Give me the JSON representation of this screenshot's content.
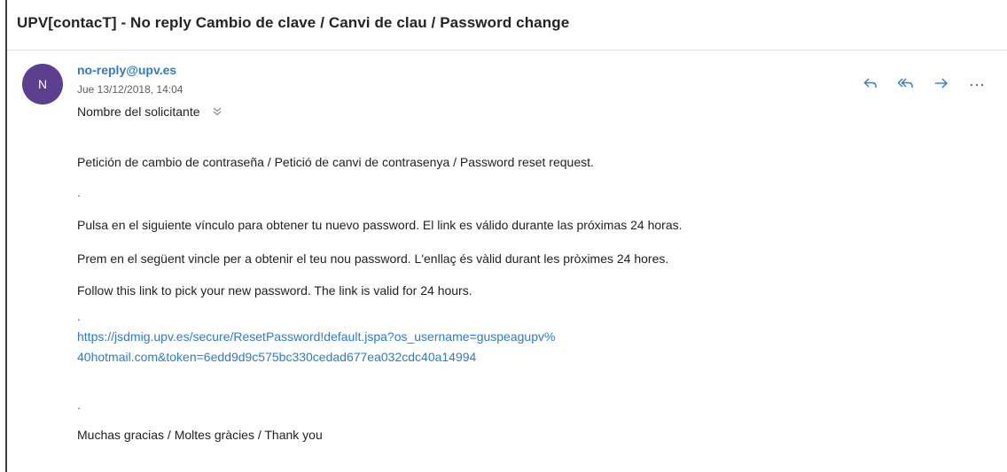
{
  "email": {
    "subject": "UPV[contacT] - No reply Cambio de clave / Canvi de clau / Password change",
    "avatar_initial": "N",
    "sender": "no-reply@upv.es",
    "date": "Jue 13/12/2018, 14:04",
    "recipient": "Nombre del solicitante",
    "body": {
      "line1": "Petición de cambio de contraseña / Petició de canvi de contrasenya / Password reset request.",
      "separator": ".",
      "line2": "Pulsa en el siguiente vínculo para obtener tu nuevo password. El link es válido durante las próximas 24 horas.",
      "line3": "Prem en el següent vincle per a obtenir el teu nou password. L'enllaç és vàlid durant les pròximes 24 hores.",
      "line4": "Follow this link to pick your new password. The link is valid for 24 hours.",
      "link_line1": "https://jsdmig.upv.es/secure/ResetPassword!default.jspa?os_username=guspeagupv%",
      "link_line2": "40hotmail.com&token=6edd9d9c575bc330cedad677ea032cdc40a14994",
      "closing": "Muchas gracias / Moltes gràcies / Thank you"
    }
  },
  "actions": {
    "reply_icon": "reply-icon",
    "reply_all_icon": "reply-all-icon",
    "forward_icon": "forward-icon",
    "more_icon": "more-icon"
  },
  "colors": {
    "accent": "#2e7bcf",
    "avatar": "#5c3f8e"
  }
}
